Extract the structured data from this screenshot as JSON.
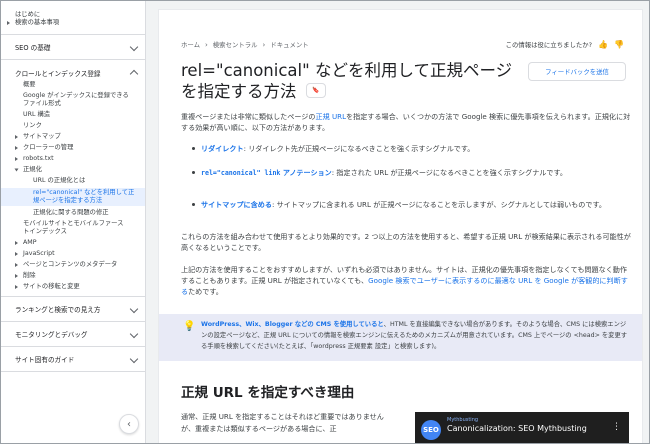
{
  "sidebar": {
    "intro": "はじめに",
    "basics": "検索の基本事項",
    "seo_basics": "SEO の基礎",
    "crawl_index": "クロールとインデックス登録",
    "items": {
      "overview": "概要",
      "accessible_files_line1": "Google がインデックスに登録できる",
      "accessible_files_line2": "ファイル形式",
      "url_structure": "URL 構造",
      "links": "リンク",
      "sitemaps": "サイトマップ",
      "crawler_management": "クローラーの管理",
      "robots": "robots.txt",
      "canonicalization": "正規化",
      "canon_what": "URL の正規化とは",
      "canon_rel_line1": "rel=\"canonical\" などを利用して正",
      "canon_rel_line2": "規ページを指定する方法",
      "canon_fix": "正規化に関する問題の修正",
      "mobile_line1": "モバイルサイトとモバイルファース",
      "mobile_line2": "トインデックス",
      "amp": "AMP",
      "javascript": "JavaScript",
      "metadata": "ページとコンテンツのメタデータ",
      "removals": "削除",
      "site_moves": "サイトの移転と変更"
    },
    "ranking": "ランキングと検索での見え方",
    "monitoring": "モニタリングとデバッグ",
    "site_guides": "サイト固有のガイド",
    "collapse_glyph": "‹"
  },
  "breadcrumb": [
    "ホーム",
    "検索セントラル",
    "ドキュメント"
  ],
  "breadcrumb_sep": "›",
  "helpful": "この情報は役に立ちましたか?",
  "title": "rel=\"canonical\" などを利用して正規ページを指定する方法",
  "feedback_button": "フィードバックを送信",
  "intro_para": {
    "p1": "重複ページまたは非常に類似したページの",
    "link": "正規 URL",
    "p2": "を指定する場合、いくつかの方法で Google 検索に優先事項を伝えられます。正規化に対する効果が高い順に、以下の方法があります。"
  },
  "bullets": {
    "b1_link": "リダイレクト",
    "b1_text": ": リダイレクト先が正規ページになるべきことを強く示すシグナルです。",
    "b2_code": "rel=\"canonical\" link",
    "b2_link": " アノテーション",
    "b2_text": ": 指定された URL が正規ページになるべきことを強く示すシグナルです。",
    "b3_link": "サイトマップに含める",
    "b3_text": ": サイトマップに含まれる URL が正規ページになることを示しますが、シグナルとしては弱いものです。"
  },
  "combine_para": "これらの方法を組み合わせて使用するとより効果的です。2 つ以上の方法を使用すると、希望する正規 URL が検索結果に表示される可能性が高くなるということです。",
  "recommend_para": {
    "p1": "上記の方法を使用することをおすすめしますが、いずれも必須ではありません。サイトは、正規化の優先事項を指定しなくても問題なく動作することもあります。正規 URL が指定されていなくても、",
    "link": "Google 検索でユーザーに表示するのに最適な URL を Google が客観的に判断する",
    "p2": "ためです。"
  },
  "note": {
    "icon_glyph": "💡",
    "bold": "WordPress、Wix、Blogger などの CMS を使用していると",
    "text": "、HTML を直接編集できない場合があります。そのような場合、CMS には検索エンジンの設定ページなど、正規 URL についての情報を検索エンジンに伝えるためのメカニズムが用意されています。CMS 上でページの <head> を変更する手順を検索してください(たとえば、「wordpress 正規要素 設定」と検索します)。"
  },
  "section": {
    "heading": "正規 URL を指定すべき理由",
    "para": "通常、正規 URL を指定することはそれほど重要ではありませんが、重複または類似するページがある場合に、正"
  },
  "video": {
    "channel": "Mythbusting",
    "title": "Canonicalization: SEO Mythbusting",
    "logo_text": "SEO",
    "menu_glyph": "⋮"
  },
  "icons": {
    "thumb_up": "👍",
    "thumb_down": "👎",
    "bookmark": "🔖"
  },
  "colors": {
    "link": "#1a73e8",
    "note_bg": "#e8eaf6",
    "active_item_bg": "#e8f0fe"
  }
}
